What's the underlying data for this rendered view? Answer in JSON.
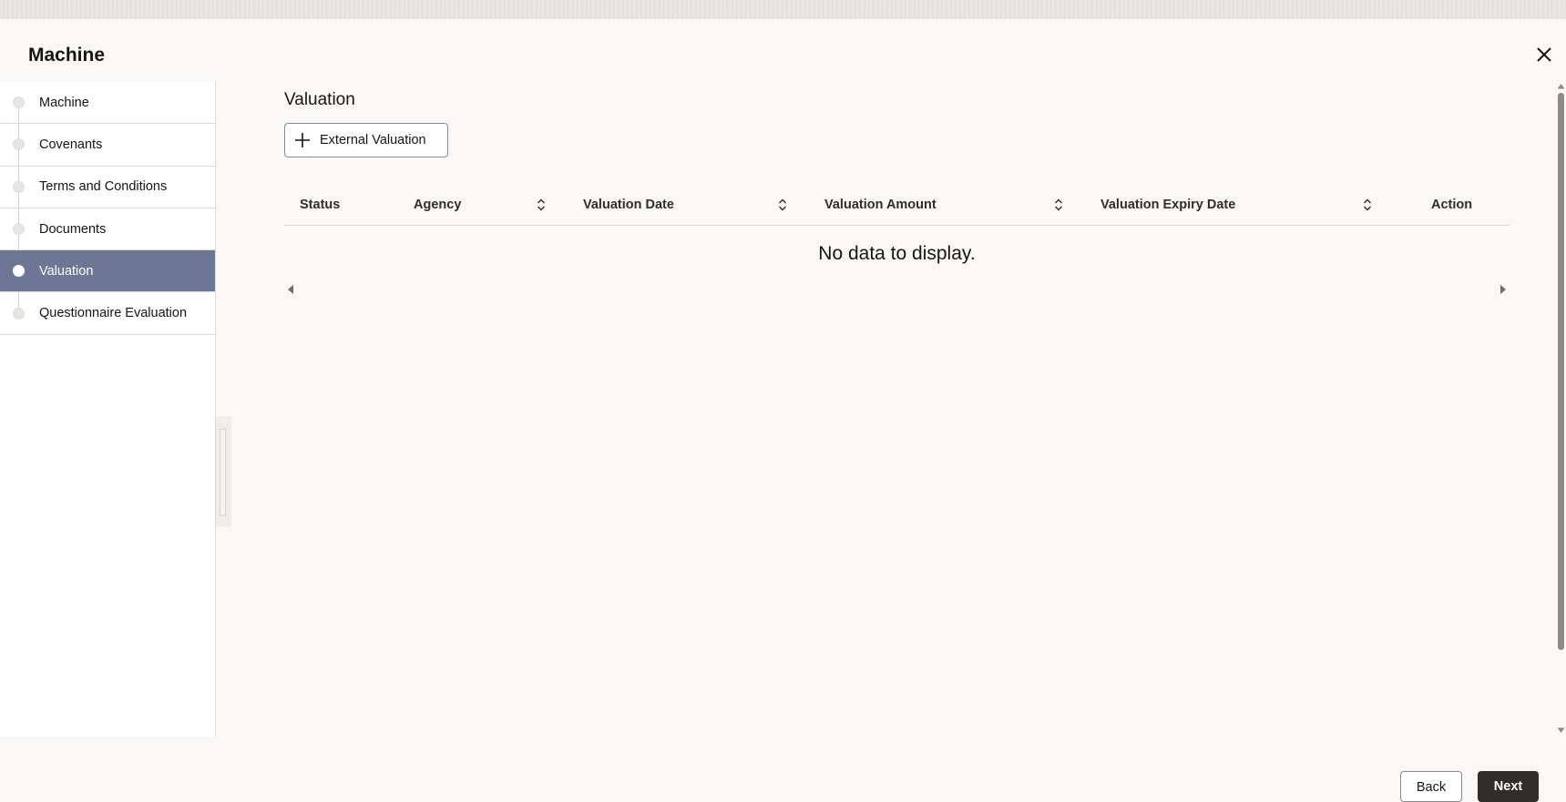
{
  "dialog": {
    "title": "Machine"
  },
  "sidebar": {
    "items": [
      {
        "label": "Machine",
        "active": false
      },
      {
        "label": "Covenants",
        "active": false
      },
      {
        "label": "Terms and Conditions",
        "active": false
      },
      {
        "label": "Documents",
        "active": false
      },
      {
        "label": "Valuation",
        "active": true
      },
      {
        "label": "Questionnaire Evaluation",
        "active": false
      }
    ]
  },
  "main": {
    "section_title": "Valuation",
    "add_button_label": "External Valuation",
    "table": {
      "columns": [
        "Status",
        "Agency",
        "Valuation Date",
        "Valuation Amount",
        "Valuation Expiry Date",
        "Action"
      ],
      "empty_message": "No data to display."
    }
  },
  "footer": {
    "back_label": "Back",
    "next_label": "Next"
  },
  "colors": {
    "active_nav": "#6c7796",
    "primary_button": "#312d2a"
  }
}
